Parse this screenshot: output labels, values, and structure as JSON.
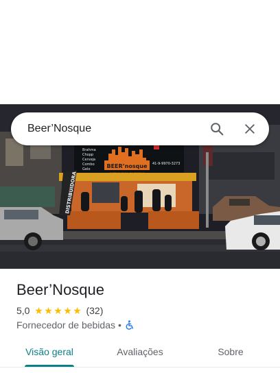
{
  "search": {
    "query": "Beer’Nosque",
    "search_icon": "search-icon",
    "close_icon": "close-icon"
  },
  "photo": {
    "sign_brand": "BEER’nosque",
    "sign_sub": "DISTRIBUIDORA DE BEBIDAS",
    "sign_phone": "41-9-9970-3273",
    "sign_menu": [
      "Brahma",
      "Chopp",
      "Cerveja",
      "Combo",
      "Gelo"
    ],
    "banner_text": "DISTRIBUIDORA"
  },
  "place": {
    "name": "Beer’Nosque",
    "rating": "5,0",
    "stars": 5,
    "review_count": "(32)",
    "category": "Fornecedor de bebidas",
    "separator": "•",
    "accessibility_icon": "wheelchair-icon"
  },
  "tabs": [
    {
      "label": "Visão geral",
      "active": true
    },
    {
      "label": "Avaliações",
      "active": false
    },
    {
      "label": "Sobre",
      "active": false
    }
  ],
  "colors": {
    "accent": "#0b7f86",
    "star": "#fbbc04"
  }
}
